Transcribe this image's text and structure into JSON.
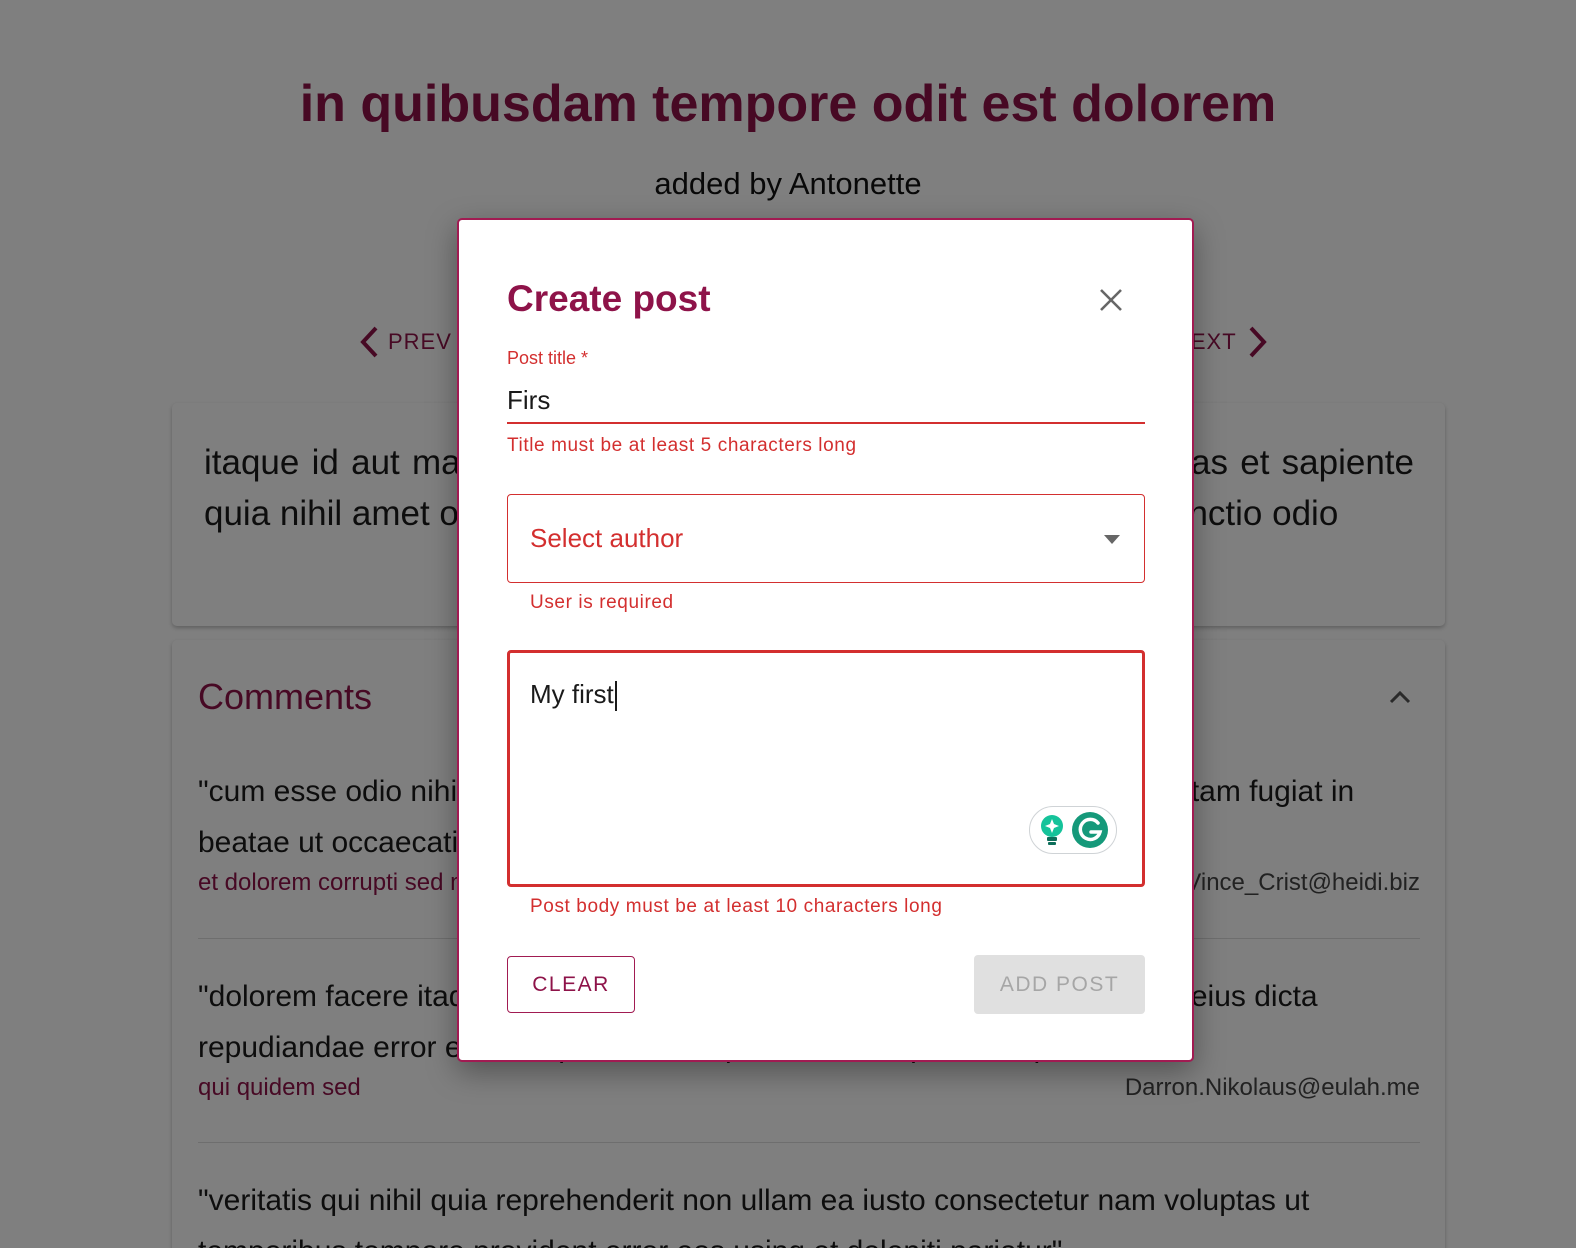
{
  "page": {
    "title": "in quibusdam tempore odit est dolorem",
    "subtitle": "added by Antonette",
    "prev_label": "PREV",
    "next_label": "NEXT",
    "body": "itaque id aut magnam praesentium quia et ea odit et ea voluptas et sapiente quia nihil amet occaecati quia id voluptatem incidunt ea est distinctio odio"
  },
  "comments": {
    "title": "Comments",
    "items": [
      {
        "body": "\"cum esse odio nihil reiciendis illum quaerat est facere quia occaecati sit totam fugiat in beatae ut occaecati unde vitae nihil quidem consequatur\"",
        "name": "et dolorem corrupti sed molestias",
        "email": "Vince_Crist@heidi.biz"
      },
      {
        "body": "\"dolorem facere itaque fuga odit autem perferendis quisquam quis corrupti eius dicta repudiandae error esse itaque aut corrupti sint consequatur aliquid\"",
        "name": "qui quidem sed",
        "email": "Darron.Nikolaus@eulah.me"
      },
      {
        "body": "\"veritatis qui nihil quia reprehenderit non ullam ea iusto consectetur nam voluptas ut temporibus tempore provident error eos using et deleniti pariatur\"",
        "name": "",
        "email": ""
      }
    ]
  },
  "dialog": {
    "title": "Create post",
    "post_title_label": "Post title *",
    "post_title_value": "Firs",
    "post_title_error": "Title must be at least 5 characters long",
    "author_placeholder": "Select author",
    "author_error": "User is required",
    "body_value": "My first",
    "body_error": "Post body must be at least 10 characters long",
    "clear_label": "CLEAR",
    "add_label": "ADD POST"
  },
  "colors": {
    "primary": "#8e1349",
    "error": "#d32f2f",
    "grammarly": "#15c39a"
  },
  "icons": [
    "chevron-left-icon",
    "chevron-right-icon",
    "chevron-up-icon",
    "close-icon",
    "dropdown-arrow-icon",
    "grammarly-suggestion-icon",
    "grammarly-icon"
  ]
}
